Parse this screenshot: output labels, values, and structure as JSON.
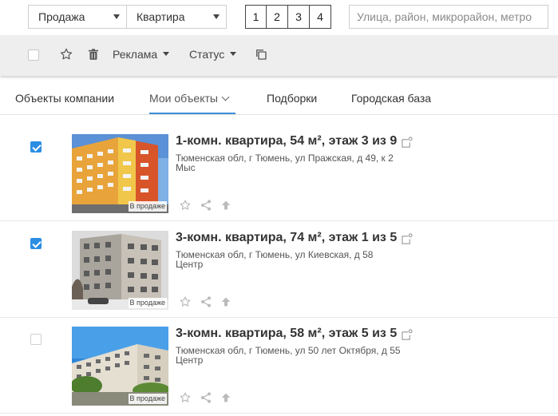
{
  "filters": {
    "deal_type": "Продажа",
    "property_type": "Квартира",
    "rooms": [
      "1",
      "2",
      "3",
      "4"
    ],
    "search_placeholder": "Улица, район, микрорайон, метро"
  },
  "toolbar": {
    "ads_label": "Реклама",
    "status_label": "Статус",
    "icons": [
      "star-outline-icon",
      "trash-icon",
      "copy-icon"
    ]
  },
  "tabs": [
    {
      "label": "Объекты компании",
      "active": false
    },
    {
      "label": "Мои объекты",
      "active": true
    },
    {
      "label": "Подборки",
      "active": false
    },
    {
      "label": "Городская база",
      "active": false
    }
  ],
  "listings": [
    {
      "title": "1-комн. квартира, 54 м², этаж 3 из 9",
      "address": "Тюменская обл, г Тюмень, ул Пражская, д 49, к 2",
      "district": "Мыс",
      "badge": "В продаже",
      "checked": true
    },
    {
      "title": "3-комн. квартира, 74 м², этаж 1 из 5",
      "address": "Тюменская обл, г Тюмень, ул Киевская, д 58",
      "district": "Центр",
      "badge": "В продаже",
      "checked": true
    },
    {
      "title": "3-комн. квартира, 58 м², этаж 5 из 5",
      "address": "Тюменская обл, г Тюмень, ул 50 лет Октября, д 55",
      "district": "Центр",
      "badge": "В продаже",
      "checked": false
    }
  ],
  "colors": {
    "accent": "#2c8ee3",
    "toolbar_bg": "#eeeeee",
    "tab_underline": "#3b8fd8"
  }
}
